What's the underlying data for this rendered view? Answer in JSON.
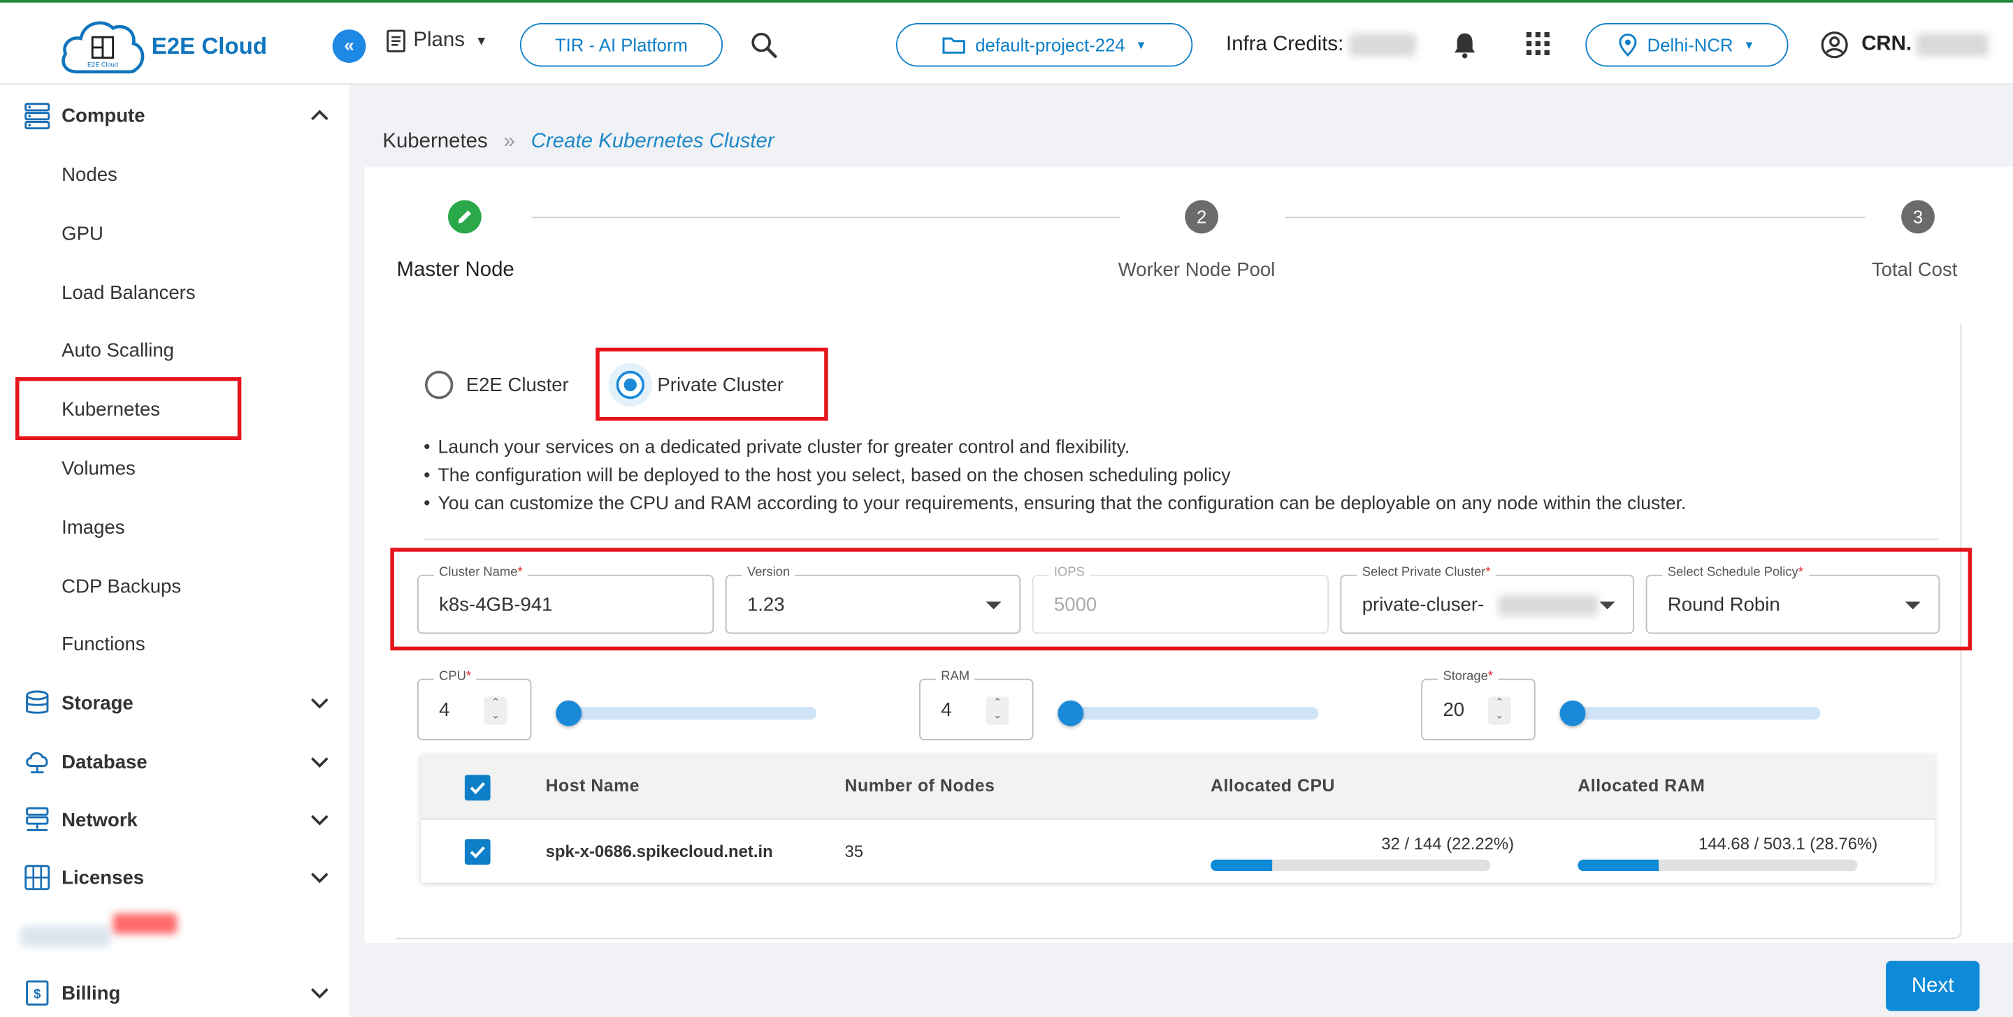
{
  "header": {
    "brand": "E2E Cloud",
    "logo_caption": "E2E Cloud",
    "plans_label": "Plans",
    "tir_label": "TIR - AI Platform",
    "project": "default-project-224",
    "infra_credits_label": "Infra Credits:",
    "region": "Delhi-NCR",
    "crn_label": "CRN."
  },
  "sidebar": {
    "compute_label": "Compute",
    "compute_items": [
      "Nodes",
      "GPU",
      "Load Balancers",
      "Auto Scalling",
      "Kubernetes",
      "Volumes",
      "Images",
      "CDP Backups",
      "Functions"
    ],
    "storage_label": "Storage",
    "database_label": "Database",
    "network_label": "Network",
    "licenses_label": "Licenses",
    "billing_label": "Billing"
  },
  "breadcrumb": {
    "parent": "Kubernetes",
    "separator": "»",
    "current": "Create Kubernetes Cluster"
  },
  "stepper": {
    "steps": [
      {
        "label": "Master Node",
        "num": ""
      },
      {
        "label": "Worker Node Pool",
        "num": "2"
      },
      {
        "label": "Total Cost",
        "num": "3"
      }
    ]
  },
  "cluster_type": {
    "option1": "E2E Cluster",
    "option2": "Private Cluster",
    "selected": "Private Cluster"
  },
  "bullets": [
    "Launch your services on a dedicated private cluster for greater control and flexibility.",
    "The configuration will be deployed to the host you select, based on the chosen scheduling policy",
    "You can customize the CPU and RAM according to your requirements, ensuring that the configuration can be deployable on any node within the cluster."
  ],
  "form": {
    "cluster_name_label": "Cluster Name",
    "cluster_name": "k8s-4GB-941",
    "version_label": "Version",
    "version": "1.23",
    "iops_label": "IOPS",
    "iops": "5000",
    "private_cluster_label": "Select Private Cluster",
    "private_cluster": "private-cluser-",
    "schedule_label": "Select Schedule Policy",
    "schedule": "Round Robin",
    "required_mark": "*"
  },
  "resources": {
    "cpu_label": "CPU",
    "cpu": "4",
    "ram_label": "RAM",
    "ram": "4",
    "storage_label": "Storage",
    "storage": "20"
  },
  "hosts_table": {
    "headers": [
      "Host Name",
      "Number of Nodes",
      "Allocated CPU",
      "Allocated RAM"
    ],
    "rows": [
      {
        "host": "spk-x-0686.spikecloud.net.in",
        "nodes": "35",
        "cpu_text": "32 / 144 (22.22%)",
        "cpu_fraction": 0.2222,
        "ram_text": "144.68 / 503.1 (28.76%)",
        "ram_fraction": 0.2876
      }
    ]
  },
  "actions": {
    "next": "Next"
  },
  "colors": {
    "primary": "#0d8ad8",
    "highlight": "#e5141d",
    "success": "#2aa84a"
  }
}
